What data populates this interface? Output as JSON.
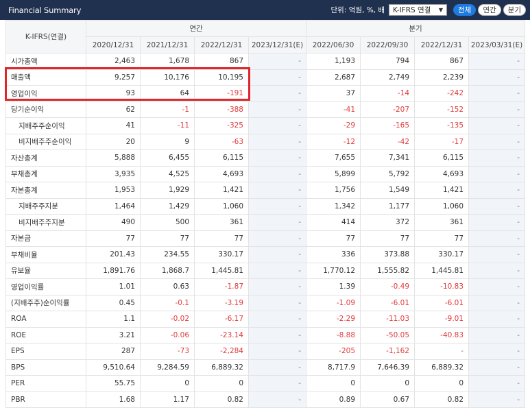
{
  "header": {
    "title": "Financial Summary",
    "unit_label": "단위: 억원, %, 배",
    "select_value": "K-IFRS 연결",
    "buttons": [
      "전체",
      "연간",
      "분기"
    ],
    "active_button": 0
  },
  "table": {
    "corner_label": "K-IFRS(연결)",
    "group_annual": "연간",
    "group_quarter": "분기",
    "columns": [
      "2020/12/31",
      "2021/12/31",
      "2022/12/31",
      "2023/12/31(E)",
      "2022/06/30",
      "2022/09/30",
      "2022/12/31",
      "2023/03/31(E)"
    ],
    "rows": [
      {
        "label": "시가총액",
        "sub": false,
        "values": [
          "2,463",
          "1,678",
          "867",
          "-",
          "1,193",
          "794",
          "867",
          "-"
        ]
      },
      {
        "label": "매출액",
        "sub": false,
        "values": [
          "9,257",
          "10,176",
          "10,195",
          "-",
          "2,687",
          "2,749",
          "2,239",
          "-"
        ]
      },
      {
        "label": "영업이익",
        "sub": false,
        "values": [
          "93",
          "64",
          "-191",
          "-",
          "37",
          "-14",
          "-242",
          "-"
        ]
      },
      {
        "label": "당기순이익",
        "sub": false,
        "values": [
          "62",
          "-1",
          "-388",
          "-",
          "-41",
          "-207",
          "-152",
          "-"
        ]
      },
      {
        "label": "지배주주순이익",
        "sub": true,
        "values": [
          "41",
          "-11",
          "-325",
          "-",
          "-29",
          "-165",
          "-135",
          "-"
        ]
      },
      {
        "label": "비지배주주순이익",
        "sub": true,
        "values": [
          "20",
          "9",
          "-63",
          "-",
          "-12",
          "-42",
          "-17",
          "-"
        ]
      },
      {
        "label": "자산총계",
        "sub": false,
        "values": [
          "5,888",
          "6,455",
          "6,115",
          "-",
          "7,655",
          "7,341",
          "6,115",
          "-"
        ]
      },
      {
        "label": "부채총계",
        "sub": false,
        "values": [
          "3,935",
          "4,525",
          "4,693",
          "-",
          "5,899",
          "5,792",
          "4,693",
          "-"
        ]
      },
      {
        "label": "자본총계",
        "sub": false,
        "values": [
          "1,953",
          "1,929",
          "1,421",
          "-",
          "1,756",
          "1,549",
          "1,421",
          "-"
        ]
      },
      {
        "label": "지배주주지분",
        "sub": true,
        "values": [
          "1,464",
          "1,429",
          "1,060",
          "-",
          "1,342",
          "1,177",
          "1,060",
          "-"
        ]
      },
      {
        "label": "비지배주주지분",
        "sub": true,
        "values": [
          "490",
          "500",
          "361",
          "-",
          "414",
          "372",
          "361",
          "-"
        ]
      },
      {
        "label": "자본금",
        "sub": false,
        "values": [
          "77",
          "77",
          "77",
          "-",
          "77",
          "77",
          "77",
          "-"
        ]
      },
      {
        "label": "부채비율",
        "sub": false,
        "values": [
          "201.43",
          "234.55",
          "330.17",
          "-",
          "336",
          "373.88",
          "330.17",
          "-"
        ]
      },
      {
        "label": "유보율",
        "sub": false,
        "values": [
          "1,891.76",
          "1,868.7",
          "1,445.81",
          "-",
          "1,770.12",
          "1,555.82",
          "1,445.81",
          "-"
        ]
      },
      {
        "label": "영업이익률",
        "sub": false,
        "values": [
          "1.01",
          "0.63",
          "-1.87",
          "-",
          "1.39",
          "-0.49",
          "-10.83",
          "-"
        ]
      },
      {
        "label": "(지배주주)순이익률",
        "sub": false,
        "values": [
          "0.45",
          "-0.1",
          "-3.19",
          "-",
          "-1.09",
          "-6.01",
          "-6.01",
          "-"
        ]
      },
      {
        "label": "ROA",
        "sub": false,
        "values": [
          "1.1",
          "-0.02",
          "-6.17",
          "-",
          "-2.29",
          "-11.03",
          "-9.01",
          "-"
        ]
      },
      {
        "label": "ROE",
        "sub": false,
        "values": [
          "3.21",
          "-0.06",
          "-23.14",
          "-",
          "-8.88",
          "-50.05",
          "-40.83",
          "-"
        ]
      },
      {
        "label": "EPS",
        "sub": false,
        "values": [
          "287",
          "-73",
          "-2,284",
          "-",
          "-205",
          "-1,162",
          "-",
          "-"
        ]
      },
      {
        "label": "BPS",
        "sub": false,
        "values": [
          "9,510.64",
          "9,284.59",
          "6,889.32",
          "-",
          "8,717.9",
          "7,646.39",
          "6,889.32",
          "-"
        ]
      },
      {
        "label": "PER",
        "sub": false,
        "values": [
          "55.75",
          "0",
          "0",
          "-",
          "0",
          "0",
          "0",
          "-"
        ]
      },
      {
        "label": "PBR",
        "sub": false,
        "values": [
          "1.68",
          "1.17",
          "0.82",
          "-",
          "0.89",
          "0.67",
          "0.82",
          "-"
        ]
      }
    ]
  },
  "colors": {
    "header_bg": "#20304f",
    "negative": "#e03b3b",
    "highlight": "#e0262b",
    "active_button": "#1f7be0"
  }
}
